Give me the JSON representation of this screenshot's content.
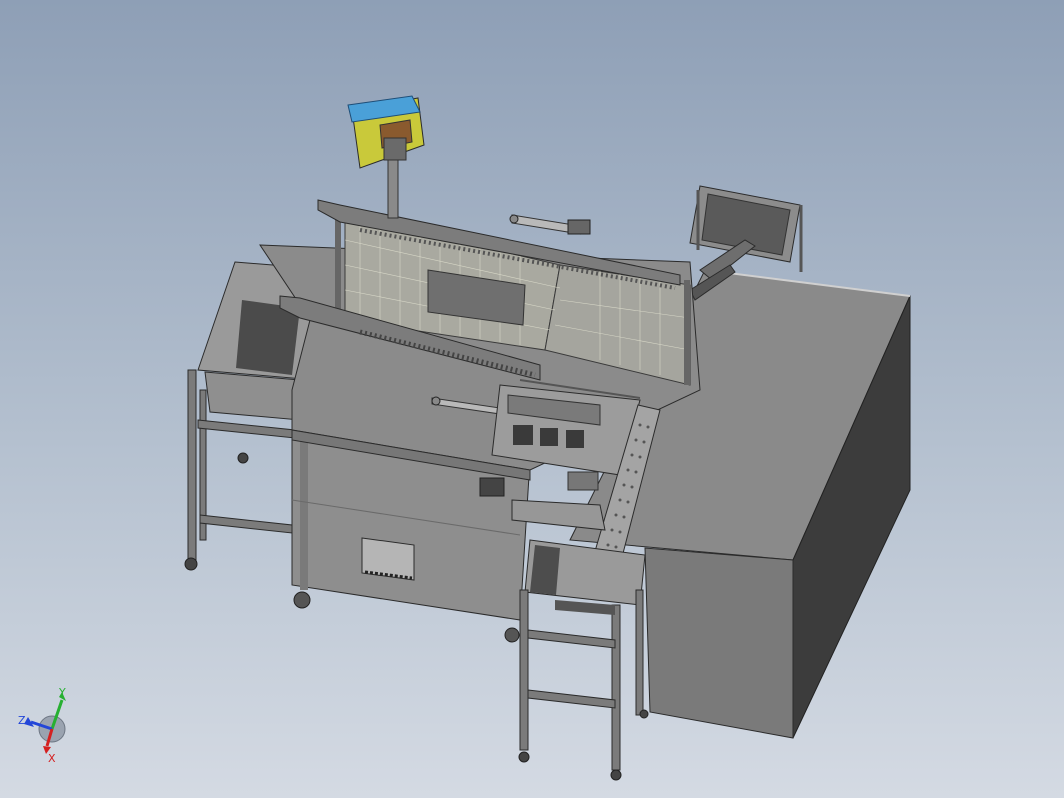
{
  "triad": {
    "x_label": "X",
    "y_label": "Y",
    "z_label": "Z",
    "x_color": "#d42020",
    "y_color": "#27b032",
    "z_color": "#2346d8"
  },
  "model": {
    "frame_color": "#7d7d7d",
    "top_color": "#8a8a8a",
    "dark_side_color": "#3e3e3e",
    "hopper_blue": "#4aa0d8",
    "panel_yellow": "#c9c93a",
    "hopper_brown": "#8a5a2e"
  }
}
